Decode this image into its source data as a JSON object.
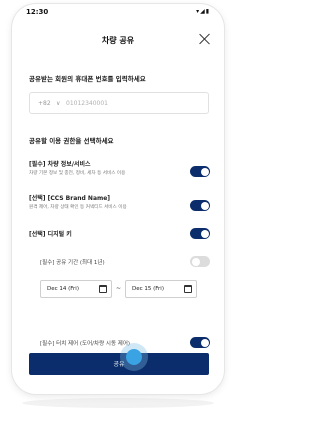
{
  "status_bar": {
    "time": "12:30",
    "icons": "▾◢▮"
  },
  "header": {
    "title": "차량 공유"
  },
  "phone_section": {
    "title": "공유받는 회원의 휴대폰 번호를 입력하세요",
    "country_code": "+82",
    "chevron": "∨",
    "placeholder": "01012340001"
  },
  "permissions": {
    "title": "공유할 이용 권한을 선택하세요",
    "items": [
      {
        "title": "[필수] 차량 정보/서비스",
        "subtitle": "차량 기본 정보 및 충전, 정비, 세차 등 서비스 이용",
        "enabled": true
      },
      {
        "title": "[선택] [CCS Brand Name]",
        "subtitle": "원격 제어, 차량 상태 확인 등 커넥티드 서비스 이용",
        "enabled": true
      },
      {
        "title": "[선택] 디지털 키",
        "subtitle": "",
        "enabled": true
      }
    ],
    "share_period": {
      "label": "[필수] 공유 기간 (최대 1년)",
      "enabled": false,
      "start_date": "Dec 14 (Fri)",
      "separator": "~",
      "end_date": "Dec 15 (Fri)"
    },
    "touch_control": {
      "label": "[필수] 터치 제어 (도어/차량 시동 제어)",
      "enabled": true
    }
  },
  "submit": {
    "label": "공유"
  },
  "colors": {
    "primary": "#0c2d6b",
    "toggle_off": "#dcdcdc",
    "touch_indicator": "#3aa3e3"
  },
  "icons": {
    "close": "close-icon",
    "calendar": "calendar-icon",
    "chevron": "chevron-down-icon"
  }
}
